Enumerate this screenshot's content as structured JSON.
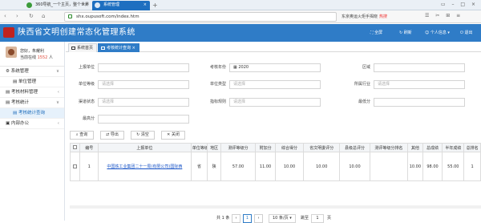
{
  "browser": {
    "tabs": [
      {
        "label": "360导航_一个主页，整个世界"
      },
      {
        "label": "系统管理"
      }
    ],
    "new_tab": "+",
    "window_controls": "▭ – □ ×",
    "back": "‹",
    "forward": "›",
    "refresh": "↻",
    "home": "⌂",
    "url": "shx.oupusoft.com/index.htm",
    "search_text": "东京奥运火炬手揭晓",
    "search_badge": "热搜",
    "toolbar_icons": "☰ ✂ ⊞ ≡"
  },
  "app": {
    "title": "陕西省文明创建常态化管理系统",
    "nav": {
      "fullscreen": "全屏",
      "refresh": "刷新",
      "profile": "个人信息",
      "logout": "退出"
    }
  },
  "user": {
    "greeting": "您好，朱耀利",
    "online_label": "当前在线",
    "online_count": "1552",
    "online_unit": "人"
  },
  "sidebar": {
    "items": [
      {
        "label": "系统管理",
        "arrow": "∨"
      },
      {
        "label": "单位管理"
      },
      {
        "label": "考核材料管理",
        "arrow": "‹"
      },
      {
        "label": "考核统计",
        "arrow": "∨"
      },
      {
        "label": "考核统计查询"
      },
      {
        "label": "内部办公",
        "arrow": "‹"
      }
    ]
  },
  "page_tabs": {
    "home": "系统首页",
    "current": "考核统计查询",
    "close": "×"
  },
  "filters": {
    "unit_label": "上报单位",
    "unit_value": "",
    "year_label": "考核年份",
    "year_value": "2020",
    "region_label": "区域",
    "region_value": "",
    "level_label": "单位等级",
    "level_placeholder": "请选择",
    "type_label": "单位类型",
    "type_placeholder": "请选择",
    "industry_label": "所属行业",
    "industry_placeholder": "请选择",
    "dept_label": "渠道状态",
    "dept_placeholder": "请选择",
    "cat_label": "指标规则",
    "cat_placeholder": "请选择",
    "score_label": "最低分",
    "score_value": "",
    "total_label": "最高分",
    "total_value": ""
  },
  "buttons": {
    "search": "查询",
    "export": "导出",
    "clear": "清空",
    "close": "关闭"
  },
  "table": {
    "headers": [
      "",
      "编号",
      "上报单位",
      "单位等级",
      "地区",
      "测评等级分",
      "附加分",
      "综合得分",
      "省文明委评分",
      "县级总评分",
      "测评等级分排名",
      "其他",
      "总成绩",
      "半年成绩",
      "总排名"
    ],
    "rows": [
      [
        "",
        "1",
        "中国铁工业集团二十一局(有限公司)国际西",
        "省",
        "陕",
        "57.00",
        "11.00",
        "10.00",
        "10.00",
        "10.00",
        "",
        "10.00",
        "98.00",
        "55.00",
        "1"
      ]
    ]
  },
  "pagination": {
    "total_text": "共 1 条",
    "prev": "‹",
    "first": "1",
    "next": "›",
    "per_page": "10 条/页",
    "jump_label": "跳至",
    "jump_value": "1",
    "page_suffix": "页"
  }
}
